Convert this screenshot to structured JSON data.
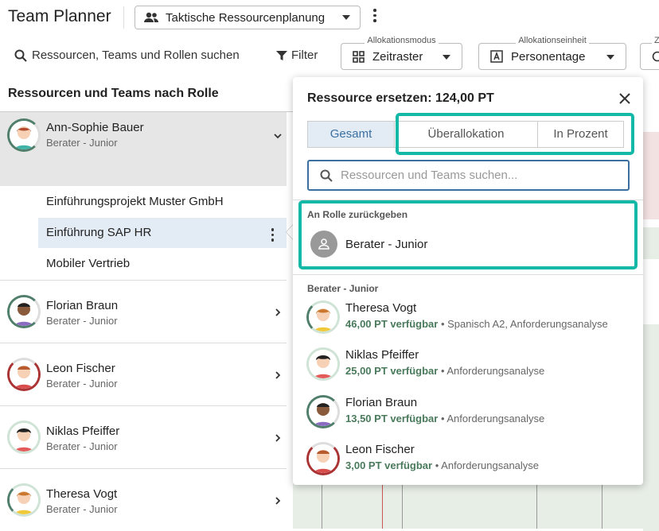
{
  "app": {
    "title": "Team Planner"
  },
  "plan_select": {
    "value": "Taktische Ressourcenplanung",
    "icon": "people-icon"
  },
  "toolbar": {
    "search_label": "Ressourcen, Teams und Rollen suchen",
    "filter_label": "Filter",
    "mode": {
      "label": "Allokationsmodus",
      "value": "Zeitraster"
    },
    "unit": {
      "label": "Allokationseinheit",
      "value": "Personentage"
    },
    "third": {
      "label": "Z"
    }
  },
  "left": {
    "header": "Ressourcen und Teams nach Rolle",
    "selected": {
      "name": "Ann-Sophie Bauer",
      "role": "Berater - Junior"
    },
    "projects": [
      "Einführungsprojekt Muster GmbH",
      "Einführung SAP HR",
      "Mobiler Vertrieb"
    ],
    "resources": [
      {
        "name": "Florian Braun",
        "role": "Berater - Junior"
      },
      {
        "name": "Leon Fischer",
        "role": "Berater - Junior"
      },
      {
        "name": "Niklas Pfeiffer",
        "role": "Berater - Junior"
      },
      {
        "name": "Theresa Vogt",
        "role": "Berater - Junior"
      }
    ]
  },
  "popup": {
    "title": "Ressource ersetzen: 124,00 PT",
    "tabs": [
      "Gesamt",
      "Überallokation",
      "In Prozent"
    ],
    "search_placeholder": "Ressourcen und Teams suchen...",
    "return_section": "An Rolle zurückgeben",
    "return_role": "Berater - Junior",
    "candidates_section": "Berater - Junior",
    "candidates": [
      {
        "name": "Theresa Vogt",
        "available": "46,00 PT verfügbar",
        "skills": "Spanisch A2, Anforderungsanalyse"
      },
      {
        "name": "Niklas Pfeiffer",
        "available": "25,00 PT verfügbar",
        "skills": "Anforderungsanalyse"
      },
      {
        "name": "Florian Braun",
        "available": "13,50 PT verfügbar",
        "skills": "Anforderungsanalyse"
      },
      {
        "name": "Leon Fischer",
        "available": "3,00 PT verfügbar",
        "skills": "Anforderungsanalyse"
      }
    ]
  },
  "colors": {
    "accent": "#3b6fa0",
    "highlight": "#14b8a6",
    "available": "#4a7a5c"
  }
}
